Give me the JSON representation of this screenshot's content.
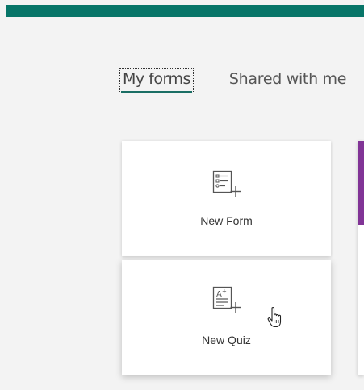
{
  "header": {
    "brand_color": "#077568"
  },
  "tabs": [
    {
      "label": "My forms",
      "selected": true
    },
    {
      "label": "Shared with me",
      "selected": false
    }
  ],
  "cards": [
    {
      "label": "New Form",
      "icon": "new-form-icon"
    },
    {
      "label": "New Quiz",
      "icon": "new-quiz-icon"
    }
  ],
  "side_card": {
    "accent_color": "#813496"
  },
  "cursor": {
    "icon": "hand-pointer-icon"
  }
}
